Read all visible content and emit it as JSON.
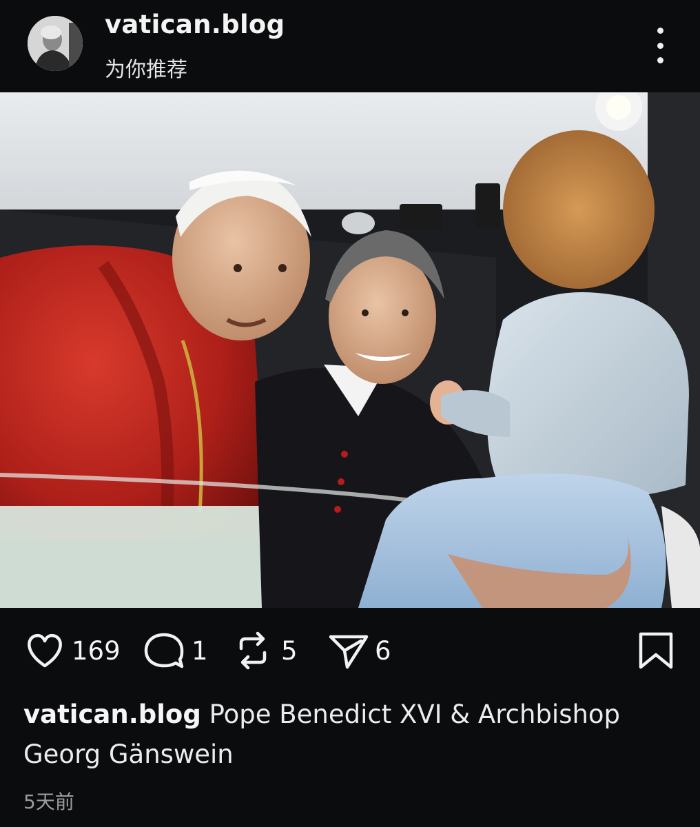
{
  "post": {
    "username": "vatican.blog",
    "subtitle": "为你推荐",
    "caption_user": "vatican.blog",
    "caption_text": "Pope Benedict XVI & Archbishop Georg Gänswein",
    "timestamp": "5天前"
  },
  "stats": {
    "likes": "169",
    "comments": "1",
    "reposts": "5",
    "shares": "6"
  },
  "icons": {
    "more": "more-vertical-icon",
    "like": "heart-icon",
    "comment": "comment-bubble-icon",
    "repost": "repost-icon",
    "share": "send-icon",
    "save": "bookmark-icon"
  },
  "colors": {
    "background": "#0b0c0e",
    "text": "#f2f2f2",
    "muted": "#9c9c9c",
    "robe_red": "#b5241c",
    "cassock_black": "#15151a"
  }
}
